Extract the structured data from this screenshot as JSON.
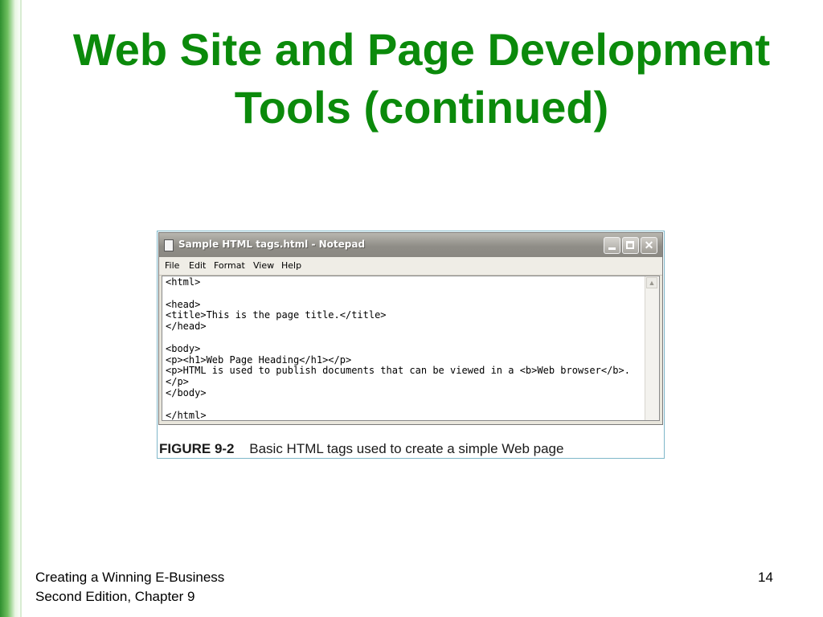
{
  "slide": {
    "title_line1": "Web Site and Page Development",
    "title_line2": "Tools (continued)",
    "footer_line1": "Creating a Winning E-Business",
    "footer_line2": "Second Edition, Chapter 9",
    "page_number": "14",
    "accent_color": "#0b8a0b"
  },
  "figure": {
    "window_title": "Sample HTML tags.html - Notepad",
    "menu": [
      "File",
      "Edit",
      "Format",
      "View",
      "Help"
    ],
    "content": "<html>\n\n<head>\n<title>This is the page title.</title>\n</head>\n\n<body>\n<p><h1>Web Page Heading</h1></p>\n<p>HTML is used to publish documents that can be viewed in a <b>Web browser</b>.</p>\n</body>\n\n</html>",
    "caption_label": "FIGURE 9-2",
    "caption_text": "Basic HTML tags used to create a simple Web page",
    "icons": [
      "notepad-icon",
      "minimize-icon",
      "maximize-icon",
      "close-icon",
      "scroll-up-arrow-icon"
    ]
  }
}
